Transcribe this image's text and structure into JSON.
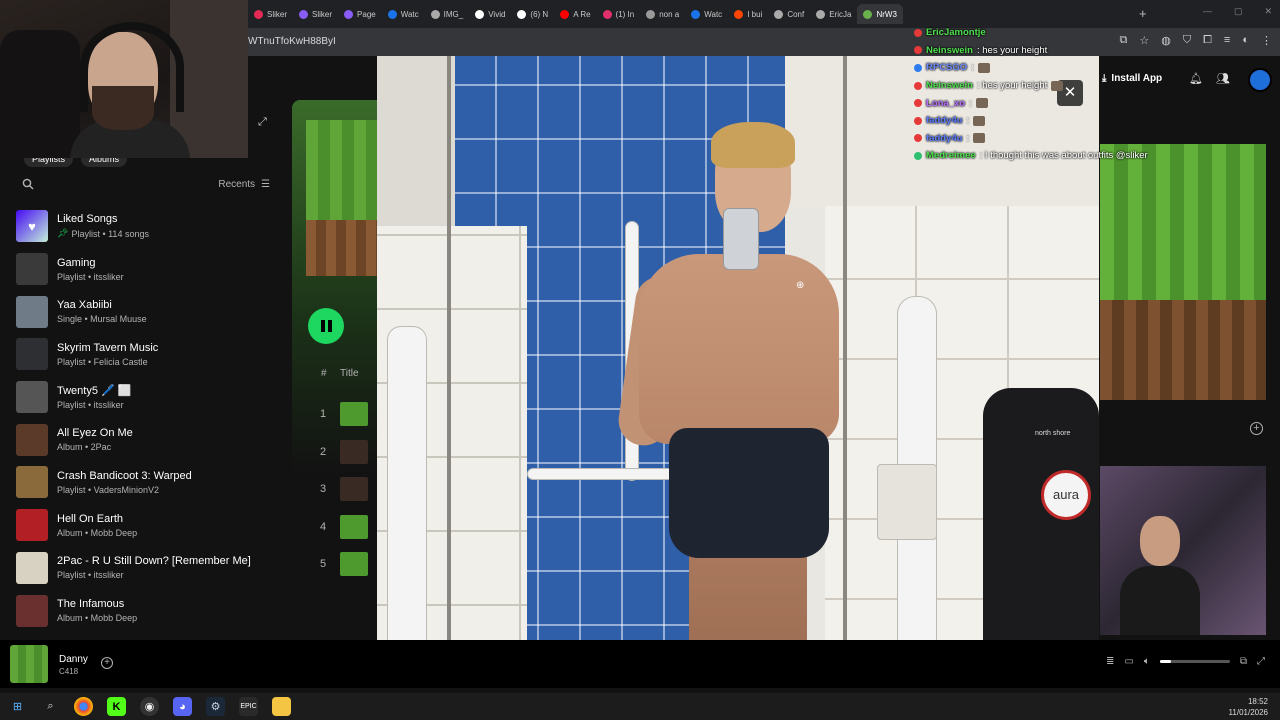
{
  "browser": {
    "tabs": [
      {
        "label": "Sliker",
        "color": "#e22a55"
      },
      {
        "label": "Sliker",
        "color": "#8a5cf6"
      },
      {
        "label": "Page",
        "color": "#8a5cf6"
      },
      {
        "label": "Watc",
        "color": "#1a73e8"
      },
      {
        "label": "IMG_",
        "color": "#aaaaaa"
      },
      {
        "label": "Vivid",
        "color": "#ffffff"
      },
      {
        "label": "(6) N",
        "color": "#ffffff"
      },
      {
        "label": "A Re",
        "color": "#ff0000"
      },
      {
        "label": "(1) In",
        "color": "#e1306c"
      },
      {
        "label": "non a",
        "color": "#999999"
      },
      {
        "label": "Watc",
        "color": "#1a73e8"
      },
      {
        "label": "I bui",
        "color": "#ff4500"
      },
      {
        "label": "Conf",
        "color": "#aaaaaa"
      },
      {
        "label": "EricJa",
        "color": "#aaaaaa"
      },
      {
        "label": "NrW3",
        "color": "#6ab04c"
      }
    ],
    "new_tab": "+",
    "url": "WTnuTfoKwH88ByI"
  },
  "header": {
    "install_label": "Install App"
  },
  "sidebar": {
    "chips": [
      "Playlists",
      "Albums"
    ],
    "recents_label": "Recents",
    "items": [
      {
        "title": "Liked Songs",
        "sub": "Playlist • 114 songs",
        "pinned": true,
        "thumb": "#6b3ef0"
      },
      {
        "title": "Gaming",
        "sub": "Playlist • itssliker",
        "thumb": "#3a3a3a"
      },
      {
        "title": "Yaa Xabiibi",
        "sub": "Single • Mursal Muuse",
        "thumb": "#6f7b86"
      },
      {
        "title": "Skyrim Tavern Music",
        "sub": "Playlist • Felicia Castle",
        "thumb": "#2d2f33"
      },
      {
        "title": "Twenty5 🖊️ ⬜",
        "sub": "Playlist • itssliker",
        "thumb": "#555555"
      },
      {
        "title": "All Eyez On Me",
        "sub": "Album • 2Pac",
        "thumb": "#5b3a2a"
      },
      {
        "title": "Crash Bandicoot 3: Warped",
        "sub": "Playlist • VadersMinionV2",
        "thumb": "#8a6a3a"
      },
      {
        "title": "Hell On Earth",
        "sub": "Album • Mobb Deep",
        "thumb": "#b21f24"
      },
      {
        "title": "2Pac - R U Still Down? [Remember Me]",
        "sub": "Playlist • itssliker",
        "thumb": "#d8d2c3"
      },
      {
        "title": "The Infamous",
        "sub": "Album • Mobb Deep",
        "thumb": "#6a3030"
      }
    ]
  },
  "main": {
    "col_hash": "#",
    "col_title": "Title",
    "tracks": [
      "1",
      "2",
      "3",
      "4",
      "5"
    ]
  },
  "now_playing": {
    "title": "Danny",
    "artist": "C418",
    "volume_fraction": 0.16
  },
  "chat": [
    {
      "user": "EricJamontje",
      "text": "",
      "color": "#4ee04e"
    },
    {
      "user": "Neinswein",
      "text": ": hes your height",
      "color": "#4ee04e"
    },
    {
      "user": "RPCSGO",
      "text": ":",
      "color": "#6c8cff"
    },
    {
      "user": "Neinswein",
      "text": ": hes your height",
      "color": "#4ee04e"
    },
    {
      "user": "Lona_xo",
      "text": ":",
      "color": "#b56cff"
    },
    {
      "user": "faddy4u",
      "text": ":",
      "color": "#5b7bff"
    },
    {
      "user": "faddy4u",
      "text": ":",
      "color": "#5b7bff"
    },
    {
      "user": "Medreimee",
      "text": ": I thought this was about outfits @sliker",
      "color": "#4ee04e"
    }
  ],
  "overlay": {
    "close_label": "✕",
    "dispenser_brand": "north shore",
    "aura_text": "aura"
  },
  "taskbar": {
    "time": "18:52",
    "date": "11/01/2026"
  }
}
